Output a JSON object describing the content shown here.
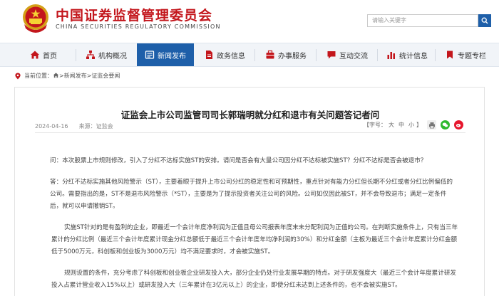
{
  "header": {
    "title": "中国证券监督管理委员会",
    "subtitle": "CHINA SECURITIES REGULATORY COMMISSION",
    "search_placeholder": "请输入关键字"
  },
  "nav": [
    {
      "label": "首页",
      "icon": "home-icon"
    },
    {
      "label": "机构概况",
      "icon": "org-chart-icon"
    },
    {
      "label": "新闻发布",
      "icon": "news-icon",
      "active": true
    },
    {
      "label": "政务信息",
      "icon": "document-icon"
    },
    {
      "label": "办事服务",
      "icon": "service-icon"
    },
    {
      "label": "互动交流",
      "icon": "chat-icon"
    },
    {
      "label": "统计信息",
      "icon": "bar-chart-icon"
    },
    {
      "label": "专题专栏",
      "icon": "topic-icon"
    }
  ],
  "breadcrumb": {
    "prefix": "当前位置：",
    "path": ">新闻发布>证监会要闻"
  },
  "article": {
    "title": "证监会上市公司监管司司长郭瑞明就分红和退市有关问题答记者问",
    "date": "2024-04-16",
    "source_label": "来源：",
    "source": "证监会",
    "font_label": "【字号：",
    "font_large": "大",
    "font_mid": "中",
    "font_small": "小",
    "font_close": "】",
    "share_icons": [
      "print-icon",
      "wechat-icon",
      "weibo-icon"
    ],
    "paragraphs": [
      "问：本次股票上市规则修改，引入了分红不达标实施ST的安排。请问是否会有大量公司因分红不达标被实施ST？分红不达标是否会被退市？",
      "答：分红不达标实施其他风险警示（ST），主要着眼于提升上市公司分红的稳定性和可预期性，重点针对有能力分红但长期不分红或者分红比例偏低的公司。需要指出的是，ST不是退市风险警示（*ST），主要是为了提示投资者关注公司的风险。公司如仅因此被ST，并不会导致退市；满足一定条件后，就可以申请撤销ST。",
      "实施ST针对的是有盈利的企业，即最近一个会计年度净利润为正值且母公司报表年度末未分配利润为正值的公司。在判断实施条件上，只有当三年累计的分红比例（最近三个会计年度累计现金分红总额低于最近三个会计年度年均净利润的30%）和分红金额（主板为最近三个会计年度累计分红金额低于5000万元，科创板和创业板为3000万元）均不满足要求时，才会被实施ST。",
      "规则设置的条件，充分考虑了科创板和创业板企业研发投入大，部分企业仍处行业发展早期的特点。对于研发强度大（最近三个会计年度累计研发投入占累计营业收入15%以上）或研发投入大（三年累计在3亿元以上）的企业，即使分红未达到上述条件的，也不会被实施ST。"
    ]
  },
  "colors": {
    "brand_red": "#c3161c",
    "nav_active": "#1e5fa9",
    "nav_bg": "#f1f4f8"
  }
}
